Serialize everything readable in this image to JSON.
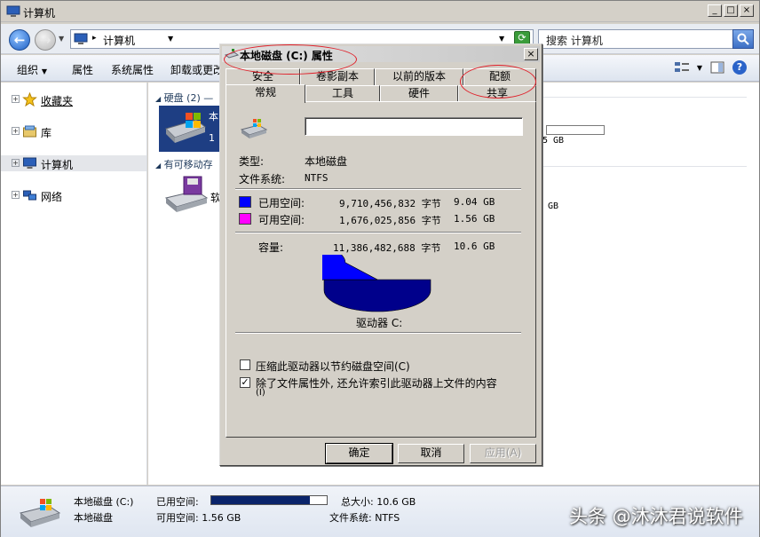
{
  "explorer": {
    "title": "计算机",
    "address_path": "计算机",
    "search_placeholder": "搜索 计算机",
    "toolbar": {
      "organize": "组织",
      "properties": "属性",
      "system_properties": "系统属性",
      "uninstall": "卸载或更改"
    },
    "nav": {
      "favorites": "收藏夹",
      "libraries": "库",
      "computer": "计算机",
      "network": "网络"
    },
    "content": {
      "hdd_group": "硬盘 (2) —",
      "removable_group": "有可移动存",
      "drive_c_name_partial": "本",
      "drive_c_sub_partial": "1",
      "removable_name_partial": "软",
      "right_text_1": "5 GB",
      "right_text_2": "GB"
    },
    "status": {
      "drive_name": "本地磁盘 (C:)",
      "used_label": "已用空间:",
      "used_fraction": 0.85,
      "total_label": "总大小: 10.6 GB",
      "drive_name_2": "本地磁盘",
      "free_label": "可用空间: 1.56 GB",
      "fs_label": "文件系统: NTFS"
    },
    "watermark": "头条 @沐沐君说软件"
  },
  "dialog": {
    "title": "本地磁盘 (C:) 属性",
    "tabs_row1": [
      "安全",
      "卷影副本",
      "以前的版本",
      "配额"
    ],
    "tabs_row2": [
      "常规",
      "工具",
      "硬件",
      "共享"
    ],
    "active_tab": "常规",
    "name_value": "",
    "type_label": "类型:",
    "type_value": "本地磁盘",
    "fs_label": "文件系统:",
    "fs_value": "NTFS",
    "used": {
      "label": "已用空间:",
      "bytes": "9,710,456,832 字节",
      "size": "9.04 GB",
      "color": "#0000ff"
    },
    "free": {
      "label": "可用空间:",
      "bytes": "1,676,025,856 字节",
      "size": "1.56 GB",
      "color": "#ff00ff"
    },
    "capacity": {
      "label": "容量:",
      "bytes": "11,386,482,688 字节",
      "size": "10.6 GB"
    },
    "drive_label": "驱动器 C:",
    "compress_label": "压缩此驱动器以节约磁盘空间(C)",
    "compress_checked": false,
    "index_label_1": "除了文件属性外, 还允许索引此驱动器上文件的内容",
    "index_label_2": "(I)",
    "index_checked": true,
    "buttons": {
      "ok": "确定",
      "cancel": "取消",
      "apply": "应用(A)"
    }
  }
}
